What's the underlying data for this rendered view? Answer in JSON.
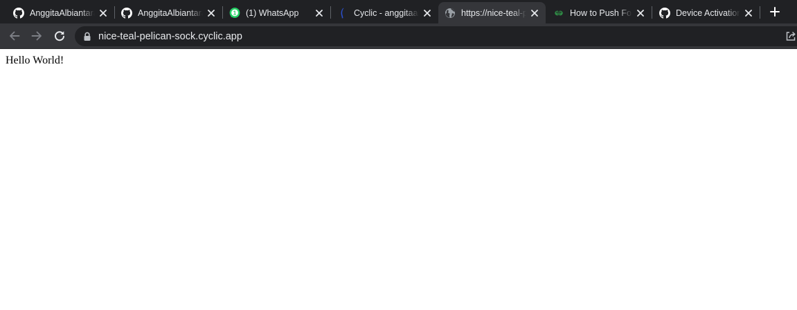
{
  "tabs": [
    {
      "title": "AnggitaAlbiantara",
      "favicon": "github-icon",
      "active": false
    },
    {
      "title": "AnggitaAlbiantara",
      "favicon": "github-icon",
      "active": false
    },
    {
      "title": "(1) WhatsApp",
      "favicon": "whatsapp-icon",
      "active": false,
      "badge": "1"
    },
    {
      "title": "Cyclic - anggitaalbiantara",
      "favicon": "cyclic-icon",
      "active": false
    },
    {
      "title": "https://nice-teal-pelican-sock.cyclic.app",
      "favicon": "globe-icon",
      "active": true
    },
    {
      "title": "How to Push Folder",
      "favicon": "geeksforgeeks-icon",
      "active": false
    },
    {
      "title": "Device Activation",
      "favicon": "github-icon",
      "active": false
    }
  ],
  "toolbar": {
    "back_icon": "arrow-left-icon",
    "forward_icon": "arrow-right-icon",
    "reload_icon": "reload-icon",
    "lock_icon": "lock-icon",
    "url": "nice-teal-pelican-sock.cyclic.app",
    "share_icon": "share-icon"
  },
  "page": {
    "text": "Hello World!"
  },
  "colors": {
    "tabstrip_bg": "#202124",
    "toolbar_bg": "#35363a",
    "omnibox_bg": "#202124",
    "text_light": "#e8eaed",
    "whatsapp_green": "#25d366",
    "geeksforgeeks_green": "#2f8d46",
    "cyclic_blue": "#2b4fc9"
  }
}
